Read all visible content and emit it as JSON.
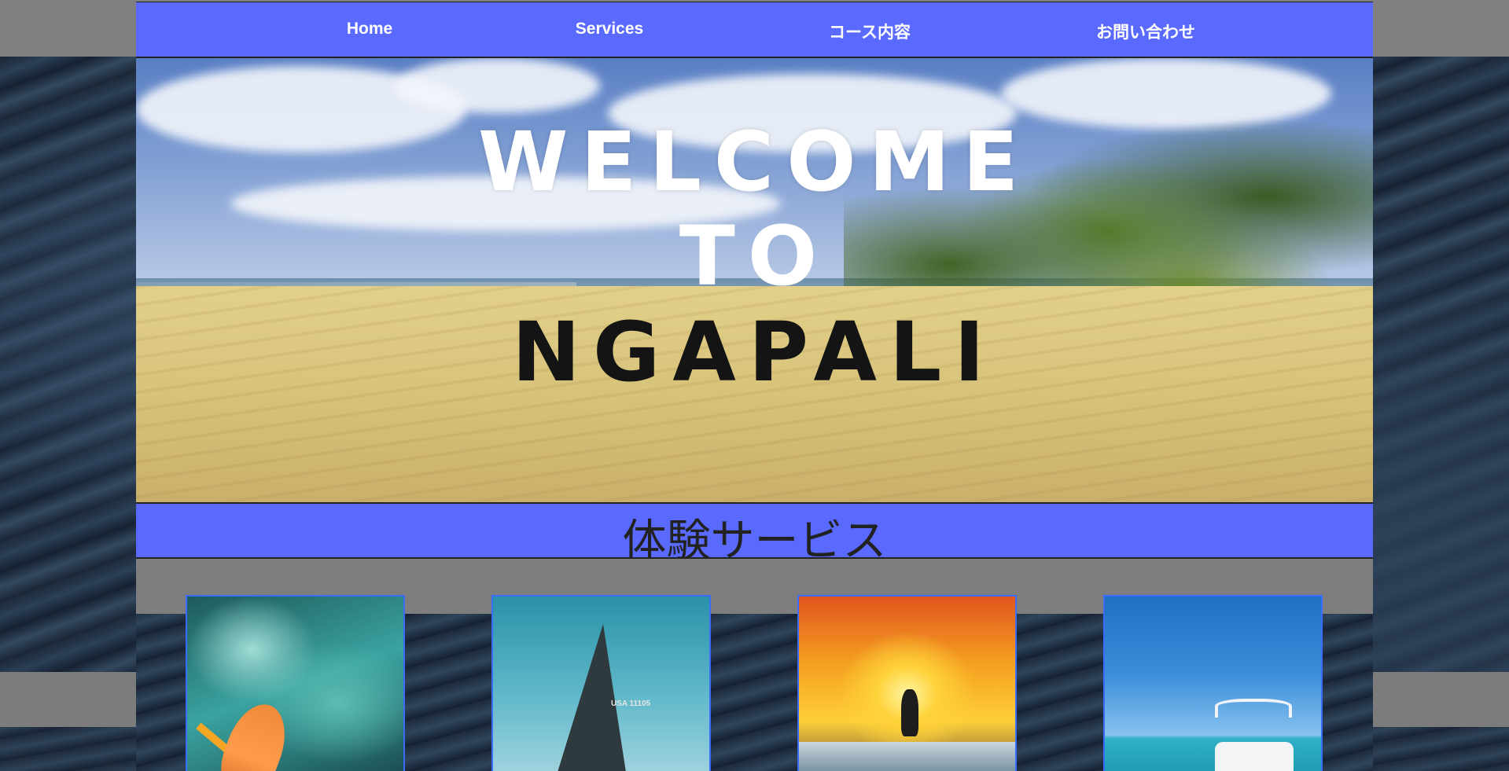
{
  "theme": {
    "nav_color": "#5a6aff",
    "card_border": "#3a6cff"
  },
  "nav": {
    "items": [
      {
        "label": "Home"
      },
      {
        "label": "Services"
      },
      {
        "label": "コース内容"
      },
      {
        "label": "お問い合わせ"
      }
    ]
  },
  "hero": {
    "line1": "WELCOME",
    "line2": "TO",
    "line3": "NGAPALI"
  },
  "services": {
    "title": "体験サービス",
    "cards": [
      {
        "image": "kayak-photo"
      },
      {
        "image": "sailboat-photo",
        "sail_text": "USA 11105"
      },
      {
        "image": "surfer-sunset-photo"
      },
      {
        "image": "motorboat-photo"
      }
    ]
  }
}
